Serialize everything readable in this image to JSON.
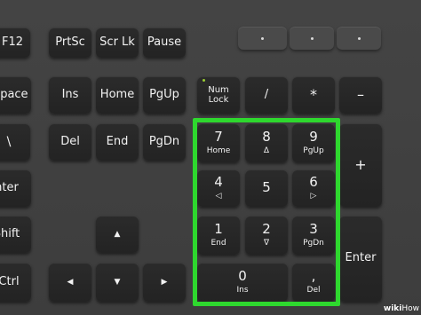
{
  "keys": {
    "f12": "F12",
    "prtsc": "PrtSc",
    "scrlk": "Scr Lk",
    "pause": "Pause",
    "backspace": "space",
    "ins": "Ins",
    "home": "Home",
    "pgup": "PgUp",
    "numlock_top": "Num",
    "numlock_bottom": "Lock",
    "divide": "/",
    "multiply": "*",
    "minus": "–",
    "backslash": "\\",
    "del": "Del",
    "end": "End",
    "pgdn": "PgDn",
    "plus": "+",
    "enter_main": "nter",
    "shift": "Shift",
    "ctrl": "Ctrl",
    "up_arrow": "▲",
    "left_arrow": "◀",
    "down_arrow": "▼",
    "right_arrow": "▶",
    "num7": "7",
    "num7_sub": "Home",
    "num8": "8",
    "num8_sub": "Δ",
    "num9": "9",
    "num9_sub": "PgUp",
    "num4": "4",
    "num4_sub": "◁",
    "num5": "5",
    "num6": "6",
    "num6_sub": "▷",
    "num1": "1",
    "num1_sub": "End",
    "num2": "2",
    "num2_sub": "∇",
    "num3": "3",
    "num3_sub": "PgDn",
    "num0": "0",
    "num0_sub": "Ins",
    "numdot": ",",
    "numdot_sub": "Del",
    "numenter": "Enter"
  },
  "indicator_dots": [
    "•",
    "•",
    "•"
  ],
  "watermark": {
    "brand": "wiki",
    "suffix": "How"
  },
  "colors": {
    "highlight": "#2ed82e",
    "key": "#262626",
    "board": "#3e3e3e"
  }
}
